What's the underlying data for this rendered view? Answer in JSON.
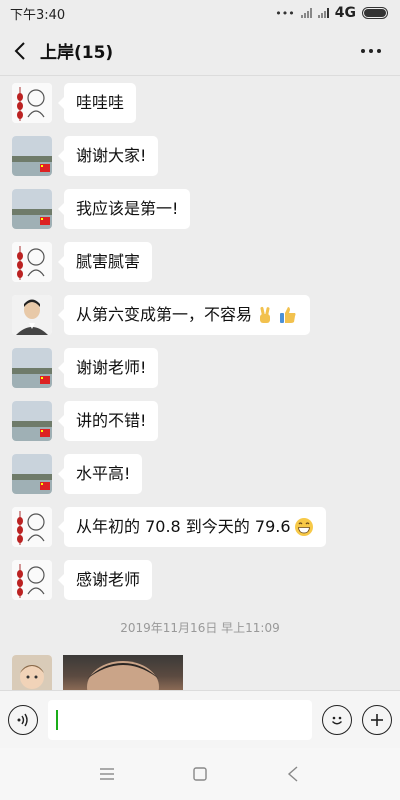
{
  "status_bar": {
    "time": "下午3:40",
    "network": "4G"
  },
  "header": {
    "title": "上岸(15)"
  },
  "messages": [
    {
      "avatar": "lantern-avatar",
      "text": "哇哇哇"
    },
    {
      "avatar": "lake-avatar",
      "text": "谢谢大家!"
    },
    {
      "avatar": "lake-avatar",
      "text": "我应该是第一!"
    },
    {
      "avatar": "lantern-avatar",
      "text": "腻害腻害"
    },
    {
      "avatar": "man-avatar",
      "text": "从第六变成第一，不容易",
      "emojis": [
        "victory-hand-emoji",
        "thumbs-up-emoji"
      ]
    },
    {
      "avatar": "lake-avatar",
      "text": "谢谢老师!"
    },
    {
      "avatar": "lake-avatar",
      "text": "讲的不错!"
    },
    {
      "avatar": "lake-avatar",
      "text": "水平高!"
    },
    {
      "avatar": "lantern-avatar",
      "text": "从年初的 70.8 到今天的 79.6",
      "emojis": [
        "grin-emoji"
      ]
    },
    {
      "avatar": "lantern-avatar",
      "text": "感谢老师"
    }
  ],
  "timestamp": "2019年11月16日 早上11:09",
  "last_message": {
    "avatar": "baby-avatar",
    "type": "photo"
  },
  "colors": {
    "background": "#ededed",
    "bubble": "#ffffff",
    "caret": "#1aad19"
  }
}
